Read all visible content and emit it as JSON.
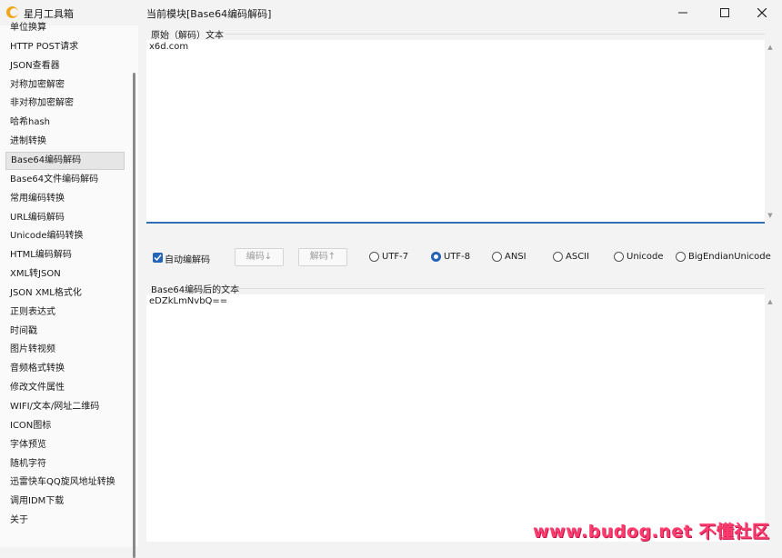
{
  "app": {
    "title": "星月工具箱"
  },
  "header": {
    "module_title": "当前模块[Base64编码解码]"
  },
  "sidebar": {
    "items": [
      {
        "label": "单位换算"
      },
      {
        "label": "HTTP POST请求"
      },
      {
        "label": "JSON查看器"
      },
      {
        "label": "对称加密解密"
      },
      {
        "label": "非对称加密解密"
      },
      {
        "label": "哈希hash"
      },
      {
        "label": "进制转换"
      },
      {
        "label": "Base64编码解码",
        "selected": true
      },
      {
        "label": "Base64文件编码解码"
      },
      {
        "label": "常用编码转换"
      },
      {
        "label": "URL编码解码"
      },
      {
        "label": "Unicode编码转换"
      },
      {
        "label": "HTML编码解码"
      },
      {
        "label": "XML转JSON"
      },
      {
        "label": "JSON XML格式化"
      },
      {
        "label": "正则表达式"
      },
      {
        "label": "时间戳"
      },
      {
        "label": "图片转视频"
      },
      {
        "label": "音频格式转换"
      },
      {
        "label": "修改文件属性"
      },
      {
        "label": "WIFI/文本/网址二维码"
      },
      {
        "label": "ICON图标"
      },
      {
        "label": "字体预览"
      },
      {
        "label": "随机字符"
      },
      {
        "label": "迅雷快车QQ旋风地址转换"
      },
      {
        "label": "调用IDM下载"
      },
      {
        "label": "关于"
      }
    ]
  },
  "source": {
    "label": "原始（解码）文本",
    "value": "x6d.com"
  },
  "controls": {
    "auto_encode_label": "自动编解码",
    "auto_encode_checked": true,
    "encode_button": "编码↓",
    "decode_button": "解码↑",
    "encodings": [
      {
        "label": "UTF-7",
        "checked": false
      },
      {
        "label": "UTF-8",
        "checked": true
      },
      {
        "label": "ANSI",
        "checked": false
      },
      {
        "label": "ASCII",
        "checked": false
      },
      {
        "label": "Unicode",
        "checked": false
      },
      {
        "label": "BigEndianUnicode",
        "checked": false
      }
    ]
  },
  "result": {
    "label": "Base64编码后的文本",
    "value": "eDZkLmNvbQ=="
  },
  "watermark": {
    "text": "www.budog.net 不懂社区"
  },
  "colors": {
    "accent": "#2463b5",
    "focus_line": "#2f6fb5",
    "watermark": "#ff3d6e",
    "app_icon": "#f0a71c"
  }
}
